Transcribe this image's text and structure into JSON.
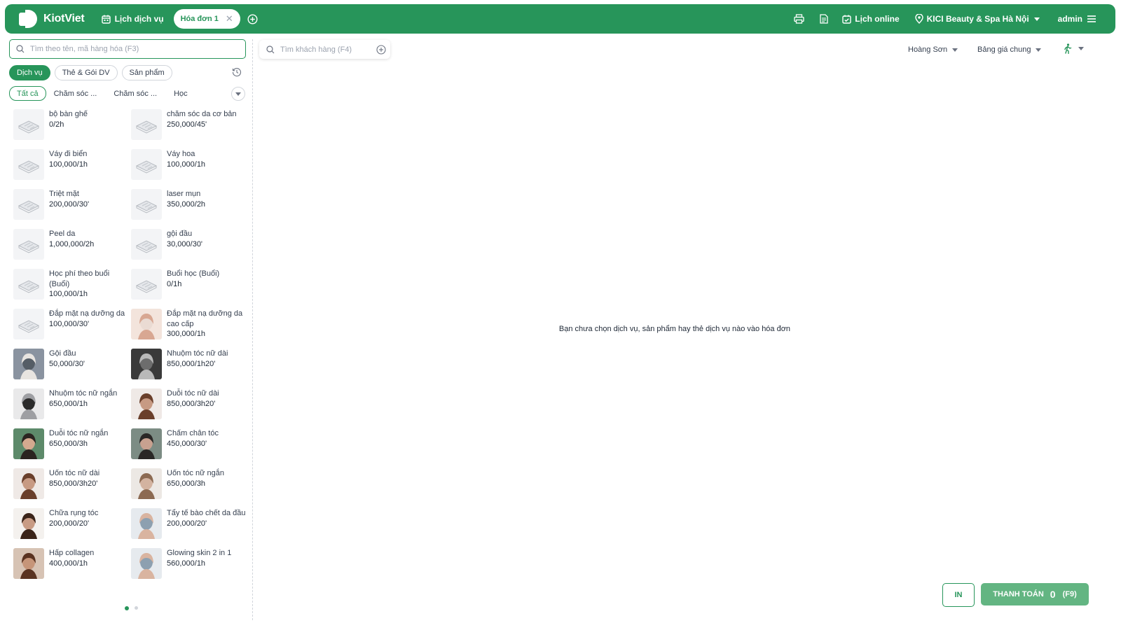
{
  "brand": {
    "name": "KiotViet"
  },
  "header": {
    "schedule_label": "Lịch dịch vụ",
    "active_tab_label": "Hóa đơn 1",
    "close_tab": "✕",
    "online_schedule_label": "Lịch online",
    "branch_label": "KICI Beauty & Spa Hà Nội",
    "user_label": "admin"
  },
  "search": {
    "product_placeholder": "Tìm theo tên, mã hàng hóa (F3)",
    "customer_placeholder": "Tìm khách hàng (F4)"
  },
  "categories": [
    "Dịch vụ",
    "Thẻ & Gói DV",
    "Sản phẩm"
  ],
  "subcategories": {
    "all_label": "Tất cả",
    "items": [
      "Chăm sóc ...",
      "Chăm sóc ...",
      "Học"
    ]
  },
  "products": [
    {
      "name": "bộ bàn ghế",
      "price": "0/2h",
      "img": "placeholder"
    },
    {
      "name": "chăm sóc da cơ bản",
      "price": "250,000/45'",
      "img": "placeholder"
    },
    {
      "name": "Váy đi biển",
      "price": "100,000/1h",
      "img": "placeholder"
    },
    {
      "name": "Váy hoa",
      "price": "100,000/1h",
      "img": "placeholder"
    },
    {
      "name": "Triệt mặt",
      "price": "200,000/30'",
      "img": "placeholder"
    },
    {
      "name": "laser mụn",
      "price": "350,000/2h",
      "img": "placeholder"
    },
    {
      "name": "Peel da",
      "price": "1,000,000/2h",
      "img": "placeholder"
    },
    {
      "name": "gội đầu",
      "price": "30,000/30'",
      "img": "placeholder"
    },
    {
      "name": "Học phí theo buổi (Buổi)",
      "price": "100,000/1h",
      "img": "placeholder"
    },
    {
      "name": "Buổi học (Buổi)",
      "price": "0/1h",
      "img": "placeholder"
    },
    {
      "name": "Đắp mặt nạ dưỡng da",
      "price": "100,000/30'",
      "img": "placeholder"
    },
    {
      "name": "Đắp mặt nạ dưỡng da cao cấp",
      "price": "300,000/1h",
      "img": "photo-mask"
    },
    {
      "name": "Gội đầu",
      "price": "50,000/30'",
      "img": "photo-wash"
    },
    {
      "name": "Nhuộm tóc nữ dài",
      "price": "850,000/1h20'",
      "img": "photo-grey"
    },
    {
      "name": "Nhuộm tóc nữ ngắn",
      "price": "650,000/1h",
      "img": "photo-silver"
    },
    {
      "name": "Duỗi tóc nữ dài",
      "price": "850,000/3h20'",
      "img": "photo-woman"
    },
    {
      "name": "Duỗi tóc nữ ngắn",
      "price": "650,000/3h",
      "img": "photo-green"
    },
    {
      "name": "Chấm chân tóc",
      "price": "450,000/30'",
      "img": "photo-dark"
    },
    {
      "name": "Uốn tóc nữ dài",
      "price": "850,000/3h20'",
      "img": "photo-woman"
    },
    {
      "name": "Uốn tóc nữ ngắn",
      "price": "650,000/3h",
      "img": "photo-curl"
    },
    {
      "name": "Chữa rụng tóc",
      "price": "200,000/20'",
      "img": "photo-lying"
    },
    {
      "name": "Tẩy tế bào chết da đầu",
      "price": "200,000/20'",
      "img": "photo-face"
    },
    {
      "name": "Hấp collagen",
      "price": "400,000/1h",
      "img": "photo-brown"
    },
    {
      "name": "Glowing skin 2 in 1",
      "price": "560,000/1h",
      "img": "photo-face"
    }
  ],
  "pagination": {
    "pages": 2,
    "current": 1
  },
  "staff_select": "Hoàng Sơn",
  "price_list_select": "Bảng giá chung",
  "empty_message": "Bạn chưa chọn dịch vụ, sản phẩm hay thẻ dịch vụ nào vào hóa đơn",
  "buttons": {
    "print": "IN",
    "pay": "THANH TOÁN",
    "pay_total": "0",
    "pay_key": "(F9)"
  },
  "colors": {
    "primary": "#27955A",
    "pay_button": "#63B582",
    "text": "#1f2937"
  }
}
